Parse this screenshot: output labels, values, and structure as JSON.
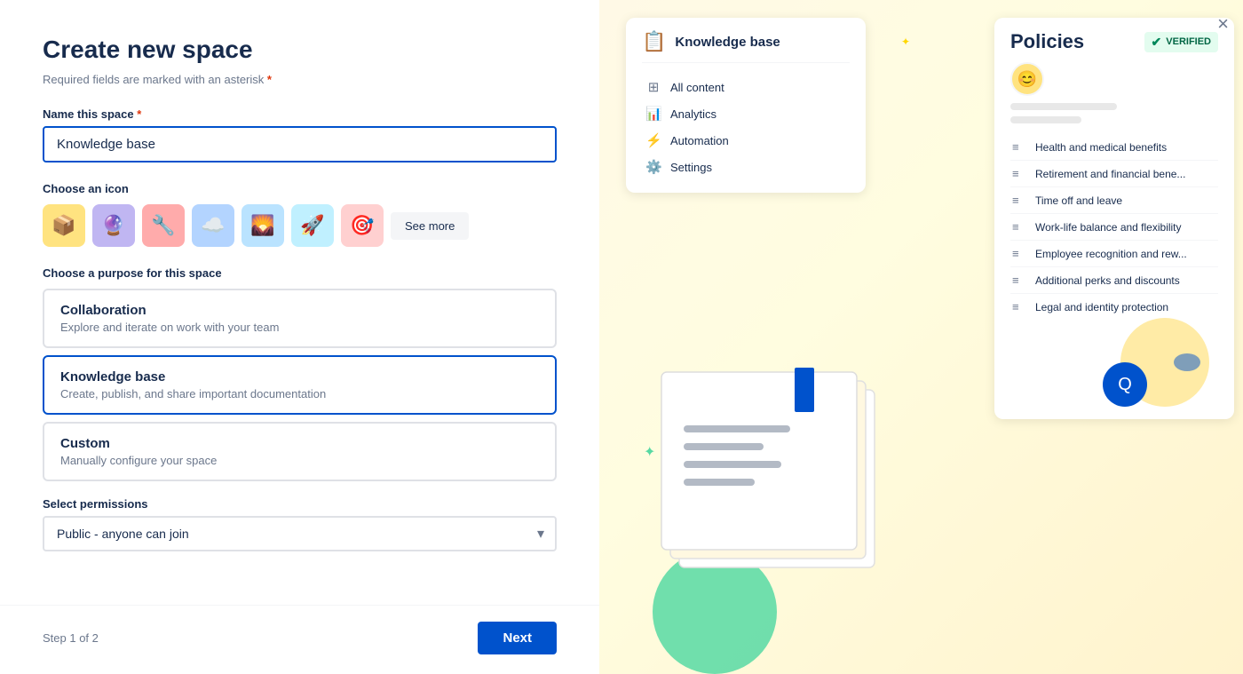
{
  "dialog": {
    "title": "Create new space",
    "required_note": "Required fields are marked with an asterisk",
    "asterisk": "*",
    "close_label": "×"
  },
  "name_field": {
    "label": "Name this space",
    "asterisk": "*",
    "value": "Knowledge base"
  },
  "icon_section": {
    "label": "Choose an icon",
    "icons": [
      {
        "emoji": "📦",
        "color": "yellow",
        "name": "box-icon"
      },
      {
        "emoji": "🔮",
        "color": "purple",
        "name": "crystal-ball-icon"
      },
      {
        "emoji": "🔧",
        "color": "red",
        "name": "wrench-icon"
      },
      {
        "emoji": "☁️",
        "color": "blue-light",
        "name": "cloud-icon"
      },
      {
        "emoji": "🌄",
        "color": "blue-sky",
        "name": "mountain-icon"
      },
      {
        "emoji": "🚀",
        "color": "pink",
        "name": "rocket-icon"
      },
      {
        "emoji": "🎯",
        "color": "red-light",
        "name": "target-icon"
      }
    ],
    "see_more_label": "See more"
  },
  "purpose_section": {
    "label": "Choose a purpose for this space",
    "options": [
      {
        "id": "collaboration",
        "title": "Collaboration",
        "description": "Explore and iterate on work with your team",
        "selected": false
      },
      {
        "id": "knowledge_base",
        "title": "Knowledge base",
        "description": "Create, publish, and share important documentation",
        "selected": true
      },
      {
        "id": "custom",
        "title": "Custom",
        "description": "Manually configure your space",
        "selected": false
      }
    ]
  },
  "permissions_section": {
    "label": "Select permissions",
    "placeholder": "Public - anyone can join"
  },
  "footer": {
    "step_text": "Step 1 of 2",
    "next_label": "Next"
  },
  "kb_card": {
    "icon": "📋",
    "title": "Knowledge base",
    "menu_items": [
      {
        "icon": "⊞",
        "label": "All content"
      },
      {
        "icon": "📊",
        "label": "Analytics"
      },
      {
        "icon": "⚡",
        "label": "Automation"
      },
      {
        "icon": "⚙️",
        "label": "Settings"
      }
    ]
  },
  "policies_card": {
    "title": "Policies",
    "verified_label": "VERIFIED",
    "list_items": [
      {
        "icon": "≡",
        "label": "Health and medical benefits"
      },
      {
        "icon": "≡",
        "label": "Retirement and financial bene..."
      },
      {
        "icon": "≡",
        "label": "Time off and leave"
      },
      {
        "icon": "≡",
        "label": "Work-life balance and flexibility"
      },
      {
        "icon": "≡",
        "label": "Employee recognition and rew..."
      },
      {
        "icon": "≡",
        "label": "Additional perks and discounts"
      },
      {
        "icon": "≡",
        "label": "Legal and identity protection"
      }
    ]
  }
}
